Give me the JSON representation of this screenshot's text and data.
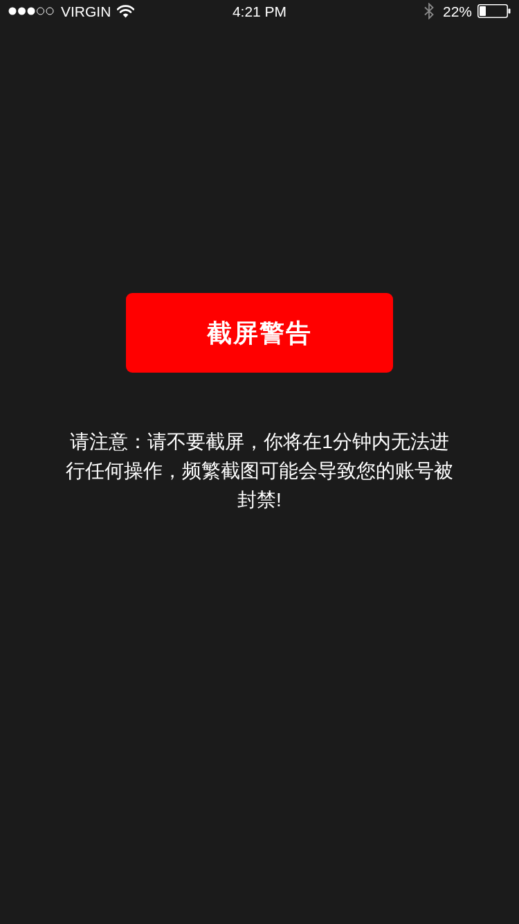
{
  "status_bar": {
    "carrier": "VIRGIN",
    "time": "4:21 PM",
    "battery_percent": "22%"
  },
  "warning_button": {
    "label": "截屏警告"
  },
  "notice": {
    "text": "请注意：请不要截屏，你将在1分钟内无法进行任何操作，频繁截图可能会导致您的账号被封禁!"
  }
}
